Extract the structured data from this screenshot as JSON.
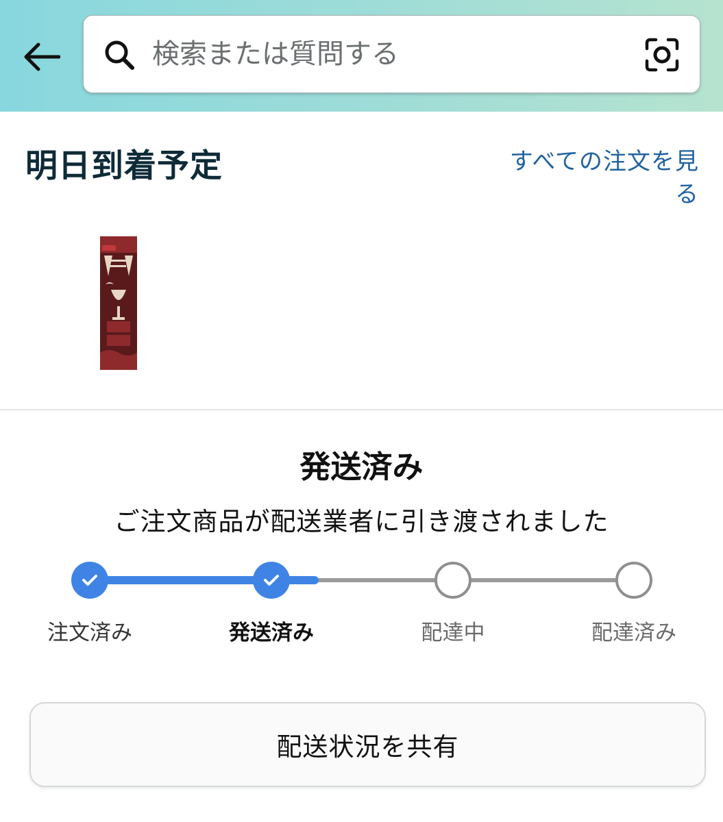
{
  "header": {
    "search_placeholder": "検索または質問する"
  },
  "delivery": {
    "title": "明日到着予定",
    "view_all_link": "すべての注文を見る"
  },
  "product": {
    "image_alt": "MONSTER",
    "image_colors": {
      "bg": "#5a1a1c",
      "band": "#8e2a2c",
      "accent": "#c0393b",
      "highlight": "#e8d6c4"
    }
  },
  "shipment": {
    "status_title": "発送済み",
    "status_description": "ご注文商品が配送業者に引き渡されました",
    "accent_color": "#3f84e5",
    "progress": {
      "completed_steps": 2,
      "total_steps": 4
    },
    "steps": [
      {
        "label": "注文済み",
        "state": "done"
      },
      {
        "label": "発送済み",
        "state": "current"
      },
      {
        "label": "配達中",
        "state": "pending"
      },
      {
        "label": "配達済み",
        "state": "pending"
      }
    ]
  },
  "actions": {
    "share_button": "配送状況を共有"
  },
  "icons": {
    "back": "arrow-left-icon",
    "search": "search-icon",
    "camera": "camera-scan-icon",
    "check": "checkmark-icon"
  }
}
